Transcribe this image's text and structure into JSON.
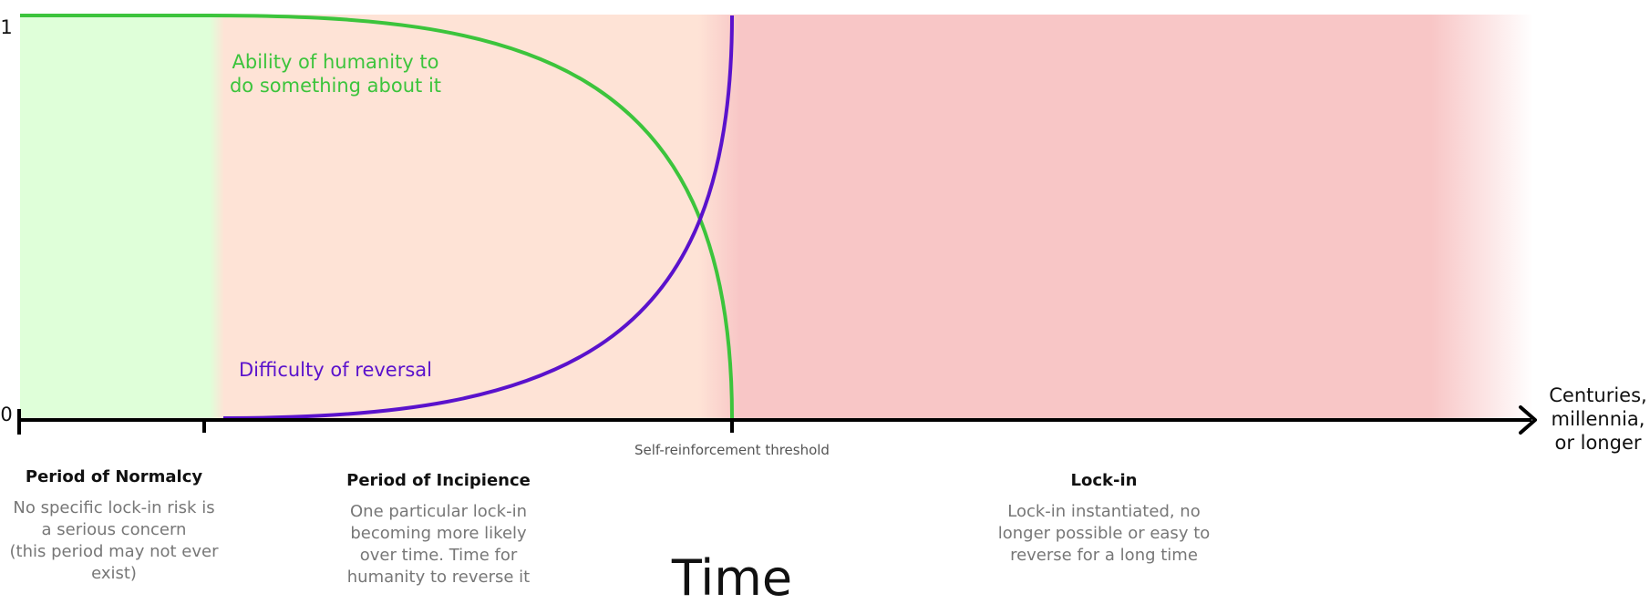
{
  "chart_data": {
    "type": "line",
    "title": "",
    "xlabel": "Time",
    "ylabel": "",
    "y_ticks": [
      "0",
      "1"
    ],
    "x_end_label": [
      "Centuries,",
      "millennia,",
      "or longer"
    ],
    "threshold_label": "Self-reinforcement threshold",
    "series": [
      {
        "name": "Ability of humanity to do something about it",
        "label_lines": [
          "Ability of humanity to",
          "do something about it"
        ],
        "color": "#3cc43c",
        "trend": "decreasing",
        "y_start": 1,
        "y_end_at_threshold": 0
      },
      {
        "name": "Difficulty of reversal",
        "label_lines": [
          "Difficulty of reversal"
        ],
        "color": "#5a12cc",
        "trend": "increasing",
        "y_start": 0,
        "y_end_at_threshold": 1
      }
    ],
    "phases": [
      {
        "title": "Period of Normalcy",
        "desc": [
          "No specific lock-in risk is",
          "a serious concern",
          "(this period may not ever",
          "exist)"
        ],
        "color": "#dfffd9"
      },
      {
        "title": "Period of Incipience",
        "desc": [
          "One particular lock-in",
          "becoming more likely",
          "over time. Time for",
          "humanity to reverse it"
        ],
        "color": "#fee3d6"
      },
      {
        "title": "Lock-in",
        "desc": [
          "Lock-in instantiated, no",
          "longer possible or easy to",
          "reverse for a long time"
        ],
        "color": "#f8c6c6"
      }
    ]
  }
}
